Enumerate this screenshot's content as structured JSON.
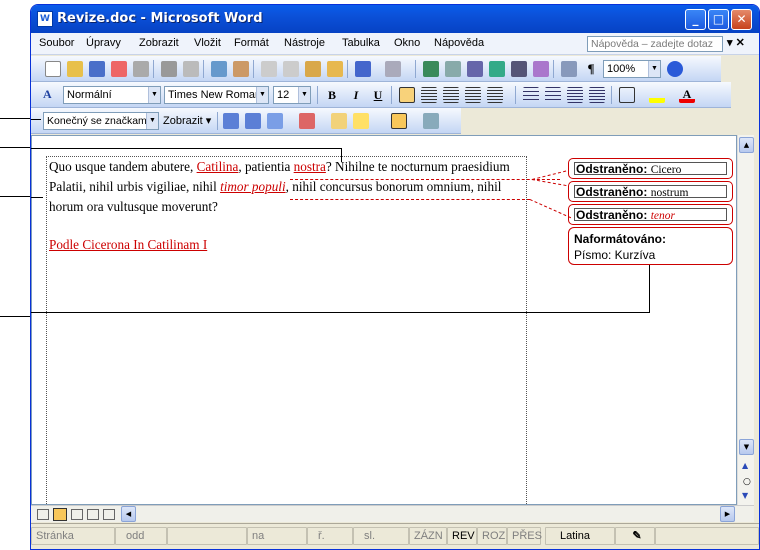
{
  "window": {
    "title": "Revize.doc - Microsoft Word",
    "icon": "word-document-icon",
    "min": "minimize-icon",
    "max": "maximize-icon",
    "close": "close-icon"
  },
  "menu": {
    "items": [
      "Soubor",
      "Úpravy",
      "Zobrazit",
      "Vložit",
      "Formát",
      "Nástroje",
      "Tabulka",
      "Okno",
      "Nápověda"
    ],
    "help_placeholder": "Nápověda – zadejte dotaz"
  },
  "standard_toolbar": {
    "zoom": "100%"
  },
  "format_toolbar": {
    "style": "Normální",
    "font": "Times New Roman",
    "size": "12",
    "bold": "B",
    "italic": "I",
    "underline": "U"
  },
  "review_toolbar": {
    "display_mode": "Konečný se značkami",
    "show_label": "Zobrazit"
  },
  "document": {
    "seg1": "Quo usque tandem abutere, ",
    "del1": "Catilina",
    "seg2": ", patientia ",
    "del2": "nostra",
    "seg3": "? Nihilne te nocturnum praesidium Palatii, nihil urbis vigiliae, nihil ",
    "fmt1": "timor populi",
    "seg4": ", nihil concursus bonorum omnium, nihil horum ora vultusque moverunt?",
    "reference": "Podle Cicerona In Catilinam I"
  },
  "balloons": [
    {
      "label": "Odstraněno:",
      "value": "Cicero"
    },
    {
      "label": "Odstraněno:",
      "value": "nostrum"
    },
    {
      "label": "Odstraněno:",
      "value": "tenor"
    },
    {
      "label": "Naformátováno:",
      "value": "Písmo: Kurzíva"
    }
  ],
  "status": {
    "page": "Stránka",
    "section": "odd",
    "at": "na",
    "line": "ř.",
    "col": "sl.",
    "rec": "ZÁZN",
    "rev": "REV",
    "ext": "ROZ",
    "ovr": "PŘES",
    "language": "Latina"
  }
}
